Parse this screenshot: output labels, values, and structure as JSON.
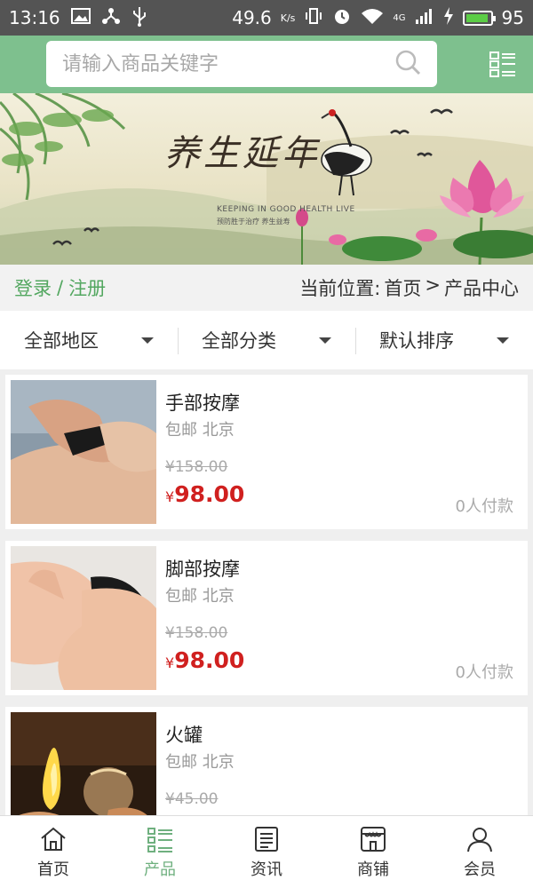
{
  "status_bar": {
    "time": "13:16",
    "speed": "49.6",
    "speed_unit": "K/s",
    "network": "4G",
    "battery": "95",
    "battery_level": 0.95
  },
  "header": {
    "search_placeholder": "请输入商品关键字",
    "search_icon": "search-icon",
    "menu_icon": "list-menu-icon"
  },
  "banner": {
    "calligraphy": "养生延年",
    "subtitle": "KEEPING IN GOOD HEALTH LIVE",
    "tagline": "预防胜于治疗  养生益寿"
  },
  "breadcrumb": {
    "login": "登录",
    "separator": "/",
    "register": "注册",
    "label": "当前位置:",
    "home": "首页",
    "arrow": ">",
    "current": "产品中心"
  },
  "filters": [
    {
      "label": "全部地区"
    },
    {
      "label": "全部分类"
    },
    {
      "label": "默认排序"
    }
  ],
  "products": [
    {
      "name": "手部按摩",
      "shipping": "包邮",
      "city": "北京",
      "old_price": "¥158.00",
      "currency": "¥",
      "price": "98.00",
      "paid": "0人付款"
    },
    {
      "name": "脚部按摩",
      "shipping": "包邮",
      "city": "北京",
      "old_price": "¥158.00",
      "currency": "¥",
      "price": "98.00",
      "paid": "0人付款"
    },
    {
      "name": "火罐",
      "shipping": "包邮",
      "city": "北京",
      "old_price": "¥45.00",
      "currency": "¥",
      "price": "",
      "paid": ""
    }
  ],
  "nav": [
    {
      "label": "首页",
      "icon": "home-icon"
    },
    {
      "label": "产品",
      "icon": "products-icon",
      "active": true
    },
    {
      "label": "资讯",
      "icon": "news-icon"
    },
    {
      "label": "商铺",
      "icon": "shop-icon"
    },
    {
      "label": "会员",
      "icon": "member-icon"
    }
  ],
  "colors": {
    "accent": "#7ec08e",
    "price": "#d0201f",
    "link": "#53a760"
  }
}
